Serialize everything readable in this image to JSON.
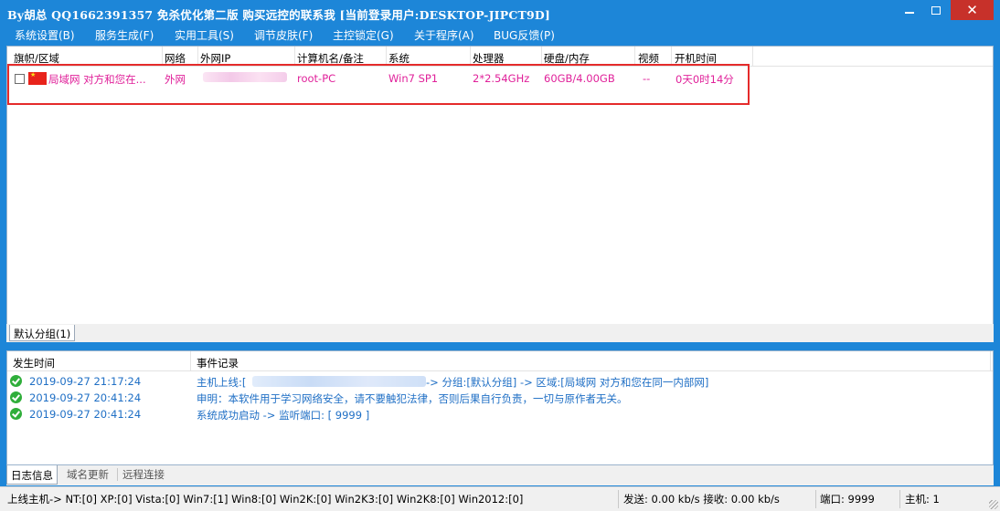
{
  "window": {
    "title": "By胡总 QQ1662391357 免杀优化第二版 购买远控的联系我 [当前登录用户:DESKTOP-JIPCT9D]",
    "controls": {
      "close_glyph": "✕"
    }
  },
  "menu": {
    "items": [
      "系统设置(B)",
      "服务生成(F)",
      "实用工具(S)",
      "调节皮肤(F)",
      "主控锁定(G)",
      "关于程序(A)",
      "BUG反馈(P)"
    ]
  },
  "host_list": {
    "columns": [
      "旗帜/区域",
      "网络",
      "外网IP",
      "计算机名/备注",
      "系统",
      "处理器",
      "硬盘/内存",
      "视频",
      "开机时间"
    ],
    "rows": [
      {
        "region": "局域网 对方和您在...",
        "network": "外网",
        "ip": "",
        "computer_name": "root-PC",
        "system": "Win7 SP1",
        "cpu": "2*2.54GHz",
        "disk_mem": "60GB/4.00GB",
        "video": "--",
        "uptime": "0天0时14分"
      }
    ],
    "row_color": "#e0219a"
  },
  "group_tabs": [
    "默认分组(1)"
  ],
  "log": {
    "columns": [
      "发生时间",
      "事件记录"
    ],
    "entries": [
      {
        "time": "2019-09-27 21:17:24",
        "text_prefix": "主机上线:[",
        "text_suffix": " -> 分组:[默认分组] -> 区域:[局域网 对方和您在同一内部网]"
      },
      {
        "time": "2019-09-27 20:41:24",
        "text": "申明：本软件用于学习网络安全，请不要触犯法律，否则后果自行负责，一切与原作者无关。"
      },
      {
        "time": "2019-09-27 20:41:24",
        "text": "系统成功启动 -> 监听端口: [ 9999 ]"
      }
    ],
    "text_color": "#1f6fc5"
  },
  "bottom_tabs": [
    "日志信息",
    "域名更新",
    "远程连接"
  ],
  "status": {
    "online": "上线主机-> NT:[0] XP:[0] Vista:[0] Win7:[1] Win8:[0] Win2K:[0] Win2K3:[0] Win2K8:[0] Win2012:[0]",
    "traffic": "发送: 0.00 kb/s 接收: 0.00 kb/s",
    "port": "端口: 9999",
    "hosts": "主机: 1"
  },
  "colors": {
    "title_bar": "#1d86d8",
    "close": "#c7312a",
    "highlight": "#e52b2b",
    "flag": "#e8231b"
  }
}
